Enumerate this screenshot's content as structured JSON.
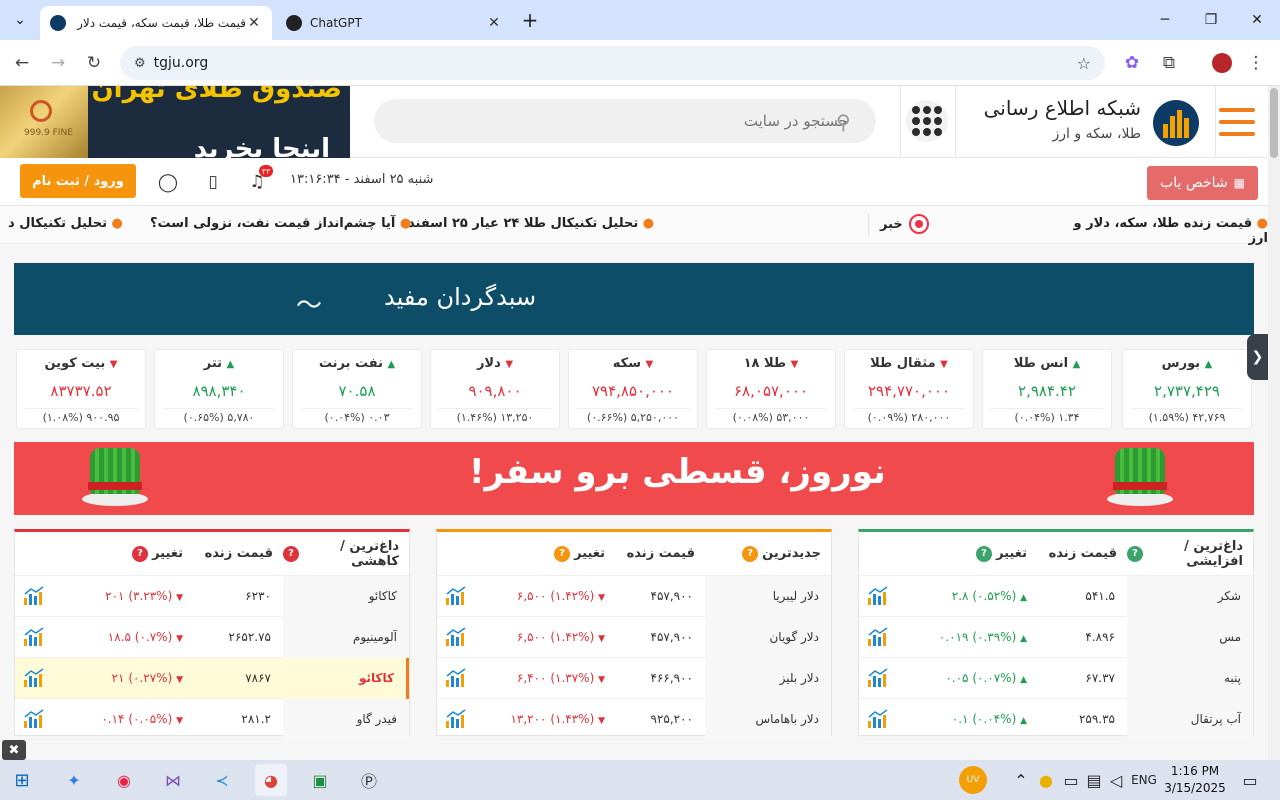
{
  "browser": {
    "tabs": [
      {
        "title": "قیمت طلا، قیمت سکه، قیمت دلار",
        "active": true
      },
      {
        "title": "ChatGPT",
        "active": false
      }
    ],
    "url": "tgju.org"
  },
  "header": {
    "ad_line1": "صندوق طلای تهران",
    "ad_line2": "اینجا بخرید",
    "gold_bar": "999.9 FINE",
    "search_placeholder": "جستجو در سایت",
    "brand_name": "شبکه اطلاع رسانی",
    "brand_sub": "طلا، سکه و ارز"
  },
  "subbar": {
    "login_label": "ورود / ثبت نام",
    "datetime": "شنبه ۲۵ اسفند - ۱۳:۱۶:۳۴",
    "notification_count": "۳۳",
    "index_finder_label": "شاخص یاب"
  },
  "ticker": {
    "live_label": "قیمت زنده طلا، سکه، دلار و ارز",
    "news_label": "خبر",
    "items": [
      "تحلیل تکنیکال طلا ۲۴ عیار ۲۵ اسفند",
      "آیا چشم‌انداز قیمت نفت، نزولی است؟",
      "تحلیل تکنیکال د"
    ]
  },
  "banner1": {
    "text": "سبدگردان مفید"
  },
  "market_cards": [
    {
      "name": "بورس",
      "price": "۲,۷۳۷,۴۲۹",
      "change": "۴۲,۷۶۹ (۱.۵۹%)",
      "dir": "up"
    },
    {
      "name": "انس طلا",
      "price": "۲,۹۸۴.۴۲",
      "change": "۱.۳۴ (۰.۰۴%)",
      "dir": "up"
    },
    {
      "name": "مثقال طلا",
      "price": "۲۹۴,۷۷۰,۰۰۰",
      "change": "۲۸۰,۰۰۰ (۰.۰۹%)",
      "dir": "down"
    },
    {
      "name": "طلا ۱۸",
      "price": "۶۸,۰۵۷,۰۰۰",
      "change": "۵۳,۰۰۰ (۰.۰۸%)",
      "dir": "down"
    },
    {
      "name": "سکه",
      "price": "۷۹۴,۸۵۰,۰۰۰",
      "change": "۵,۲۵۰,۰۰۰ (۰.۶۶%)",
      "dir": "down"
    },
    {
      "name": "دلار",
      "price": "۹۰۹,۸۰۰",
      "change": "۱۳,۲۵۰ (۱.۴۶%)",
      "dir": "down"
    },
    {
      "name": "نفت برنت",
      "price": "۷۰.۵۸",
      "change": "۰.۰۳ (۰.۰۴%)",
      "dir": "up"
    },
    {
      "name": "تتر",
      "price": "۸۹۸,۳۴۰",
      "change": "۵,۷۸۰ (۰.۶۵%)",
      "dir": "up"
    },
    {
      "name": "بیت کوین",
      "price": "۸۳۷۳۷.۵۲",
      "change": "۹۰۰.۹۵ (۱.۰۸%)",
      "dir": "down"
    }
  ],
  "banner2": {
    "text": "نوروز، قسطی برو سفر!"
  },
  "tables": [
    {
      "id": "hot-up",
      "title": "داغ‌ترین / افزایشی",
      "col_price": "قیمت زنده",
      "col_change": "تغییر",
      "accent": "#3aa46b",
      "rows": [
        {
          "name": "شکر",
          "price": "۵۴۱.۵",
          "change": "(۰.۵۲%) ۲.۸",
          "dir": "up"
        },
        {
          "name": "مس",
          "price": "۴.۸۹۶",
          "change": "(۰.۳۹%) ۰.۰۱۹",
          "dir": "up"
        },
        {
          "name": "پنبه",
          "price": "۶۷.۳۷",
          "change": "(۰.۰۷%) ۰.۰۵",
          "dir": "up"
        },
        {
          "name": "آب پرتقال",
          "price": "۲۵۹.۳۵",
          "change": "(۰.۰۴%) ۰.۱",
          "dir": "up"
        }
      ]
    },
    {
      "id": "latest",
      "title": "جدیدترین",
      "col_price": "قیمت زنده",
      "col_change": "تغییر",
      "accent": "#f7940d",
      "rows": [
        {
          "name": "دلار لیبریا",
          "price": "۴۵۷,۹۰۰",
          "change": "(۱.۴۲%) ۶,۵۰۰",
          "dir": "down"
        },
        {
          "name": "دلار گویان",
          "price": "۴۵۷,۹۰۰",
          "change": "(۱.۴۲%) ۶,۵۰۰",
          "dir": "down"
        },
        {
          "name": "دلار بلیز",
          "price": "۴۶۶,۹۰۰",
          "change": "(۱.۳۷%) ۶,۴۰۰",
          "dir": "down"
        },
        {
          "name": "دلار باهاماس",
          "price": "۹۲۵,۲۰۰",
          "change": "(۱.۴۳%) ۱۳,۲۰۰",
          "dir": "down"
        }
      ]
    },
    {
      "id": "hot-down",
      "title": "داغ‌ترین / کاهشی",
      "col_price": "قیمت زنده",
      "col_change": "تغییر",
      "accent": "#e0323b",
      "rows": [
        {
          "name": "کاکائو",
          "price": "۶۲۳۰",
          "change": "(۳.۲۳%) ۲۰۱",
          "dir": "down"
        },
        {
          "name": "آلومینیوم",
          "price": "۲۶۵۲.۷۵",
          "change": "(۰.۷%) ۱۸.۵",
          "dir": "down"
        },
        {
          "name": "کاکائو",
          "price": "۷۸۶۷",
          "change": "(۰.۲۷%) ۲۱",
          "dir": "down",
          "highlight": true
        },
        {
          "name": "فیدر گاو",
          "price": "۲۸۱.۲",
          "change": "(۰.۰۵%) ۰.۱۴",
          "dir": "down"
        }
      ]
    }
  ],
  "taskbar": {
    "time": "1:16 PM",
    "date": "3/15/2025",
    "lang": "ENG",
    "uv_label": "UV"
  },
  "colors": {
    "up": "#1e9e52",
    "down": "#e0323b",
    "brand_orange": "#f7940d"
  }
}
